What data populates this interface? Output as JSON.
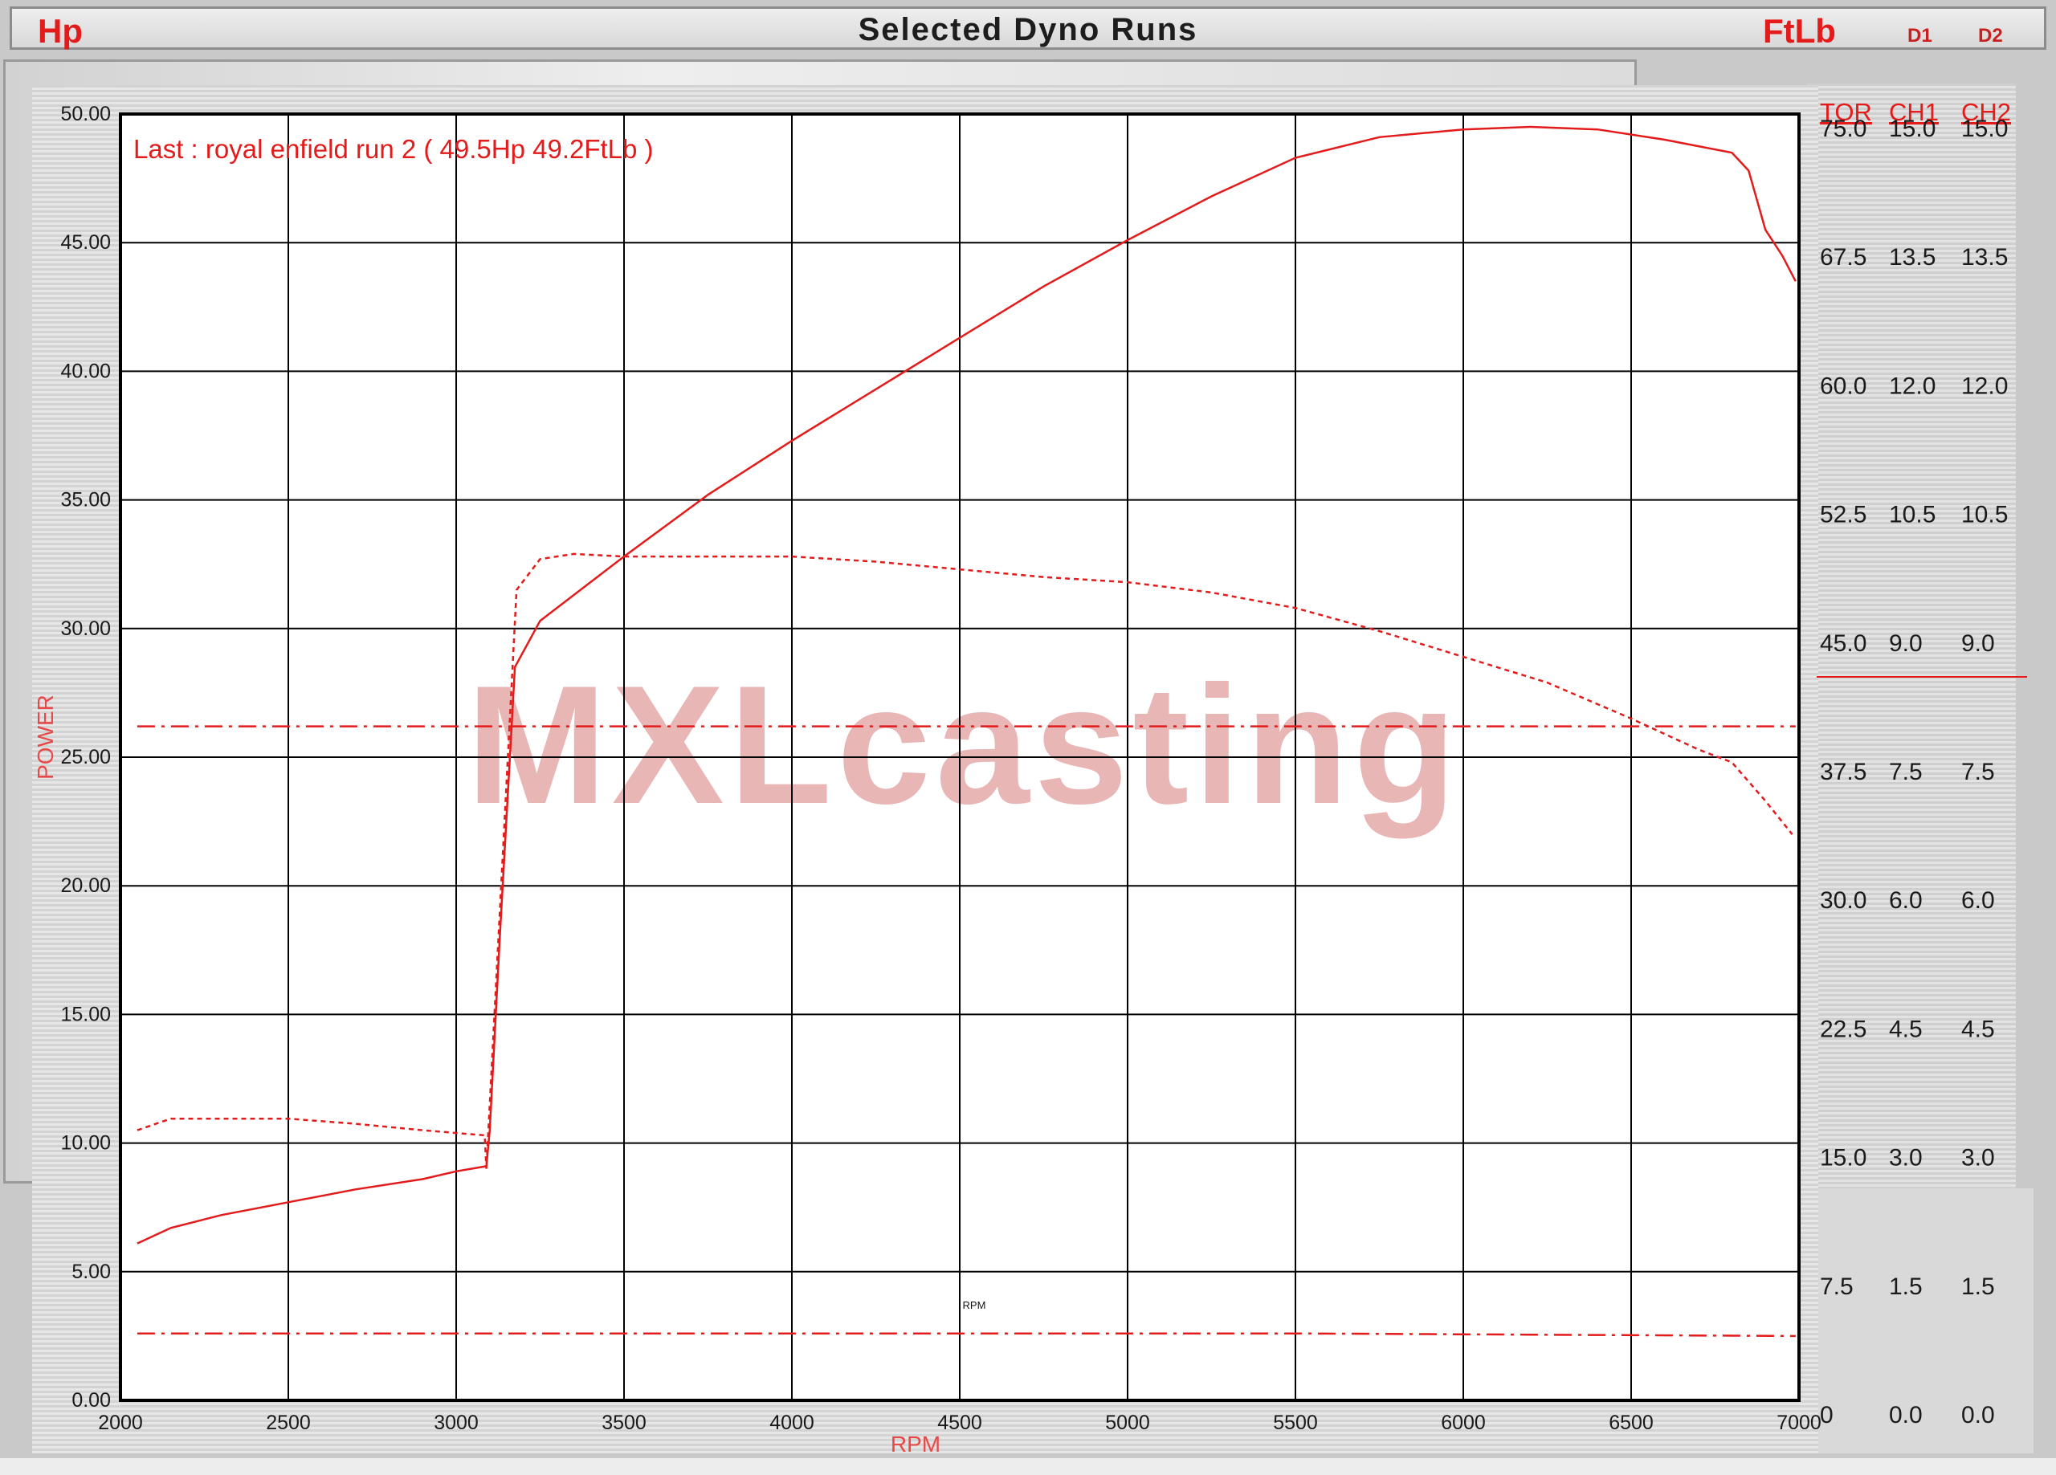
{
  "header": {
    "left_unit": "Hp",
    "title": "Selected Dyno Runs",
    "right_unit": "FtLb",
    "d1": "D1",
    "d2": "D2"
  },
  "watermark": "MXLcasting",
  "colors": {
    "curve": "#e31b1b",
    "grid": "#000000",
    "plot_bg": "#ffffff"
  },
  "chart_data": {
    "type": "line",
    "annotation": "Last : royal enfield run 2 ( 49.5Hp  49.2FtLb )",
    "xlabel": "RPM",
    "xlabel_small": "RPM",
    "ylabel": "POWER",
    "xlim": [
      2000,
      7000
    ],
    "ylim": [
      0,
      50
    ],
    "x_ticks": [
      "2000",
      "2500",
      "3000",
      "3500",
      "4000",
      "4500",
      "5000",
      "5500",
      "6000",
      "6500",
      "7000"
    ],
    "y_ticks": [
      "0.00",
      "5.00",
      "10.00",
      "15.00",
      "20.00",
      "25.00",
      "30.00",
      "35.00",
      "40.00",
      "45.00",
      "50.00"
    ],
    "right_axes": {
      "headers": [
        "TOR",
        "CH1",
        "CH2"
      ],
      "TOR": [
        "75.0",
        "67.5",
        "60.0",
        "52.5",
        "45.0",
        "37.5",
        "30.0",
        "22.5",
        "15.0",
        "7.5",
        "0"
      ],
      "CH1": [
        "15.0",
        "13.5",
        "12.0",
        "10.5",
        "9.0",
        "7.5",
        "6.0",
        "4.5",
        "3.0",
        "1.5",
        "0.0"
      ],
      "CH2": [
        "15.0",
        "13.5",
        "12.0",
        "10.5",
        "9.0",
        "7.5",
        "6.0",
        "4.5",
        "3.0",
        "1.5",
        "0.0"
      ]
    },
    "grid": true,
    "series": [
      {
        "style": "solid",
        "points": [
          [
            2050,
            6.1
          ],
          [
            2150,
            6.7
          ],
          [
            2300,
            7.2
          ],
          [
            2500,
            7.7
          ],
          [
            2700,
            8.2
          ],
          [
            2900,
            8.6
          ],
          [
            3000,
            8.9
          ],
          [
            3090,
            9.1
          ],
          [
            3100,
            10.5
          ],
          [
            3130,
            18
          ],
          [
            3160,
            25
          ],
          [
            3175,
            28.5
          ],
          [
            3250,
            30.3
          ],
          [
            3400,
            31.8
          ],
          [
            3500,
            32.8
          ],
          [
            3750,
            35.2
          ],
          [
            4000,
            37.3
          ],
          [
            4250,
            39.3
          ],
          [
            4500,
            41.3
          ],
          [
            4750,
            43.3
          ],
          [
            5000,
            45.1
          ],
          [
            5250,
            46.8
          ],
          [
            5500,
            48.3
          ],
          [
            5750,
            49.1
          ],
          [
            6000,
            49.4
          ],
          [
            6200,
            49.5
          ],
          [
            6400,
            49.4
          ],
          [
            6600,
            49.0
          ],
          [
            6800,
            48.5
          ],
          [
            6850,
            47.8
          ],
          [
            6900,
            45.5
          ],
          [
            6950,
            44.5
          ],
          [
            6990,
            43.5
          ]
        ]
      },
      {
        "style": "dashed",
        "points": [
          [
            2050,
            10.5
          ],
          [
            2150,
            10.95
          ],
          [
            2300,
            10.95
          ],
          [
            2500,
            10.95
          ],
          [
            2700,
            10.75
          ],
          [
            2900,
            10.5
          ],
          [
            3085,
            10.3
          ],
          [
            3090,
            9.0
          ],
          [
            3110,
            14
          ],
          [
            3150,
            24
          ],
          [
            3180,
            31.5
          ],
          [
            3250,
            32.7
          ],
          [
            3350,
            32.9
          ],
          [
            3500,
            32.8
          ],
          [
            3750,
            32.8
          ],
          [
            4000,
            32.8
          ],
          [
            4250,
            32.6
          ],
          [
            4500,
            32.3
          ],
          [
            4750,
            32.0
          ],
          [
            5000,
            31.8
          ],
          [
            5250,
            31.4
          ],
          [
            5500,
            30.8
          ],
          [
            5750,
            29.9
          ],
          [
            6000,
            28.9
          ],
          [
            6250,
            27.9
          ],
          [
            6500,
            26.5
          ],
          [
            6700,
            25.3
          ],
          [
            6800,
            24.8
          ],
          [
            6900,
            23.3
          ],
          [
            6980,
            22.0
          ]
        ]
      },
      {
        "style": "dashdot",
        "points": [
          [
            2050,
            26.2
          ],
          [
            6990,
            26.2
          ]
        ]
      },
      {
        "style": "dashdot",
        "points": [
          [
            2050,
            2.6
          ],
          [
            5500,
            2.6
          ],
          [
            6990,
            2.5
          ]
        ]
      }
    ]
  }
}
